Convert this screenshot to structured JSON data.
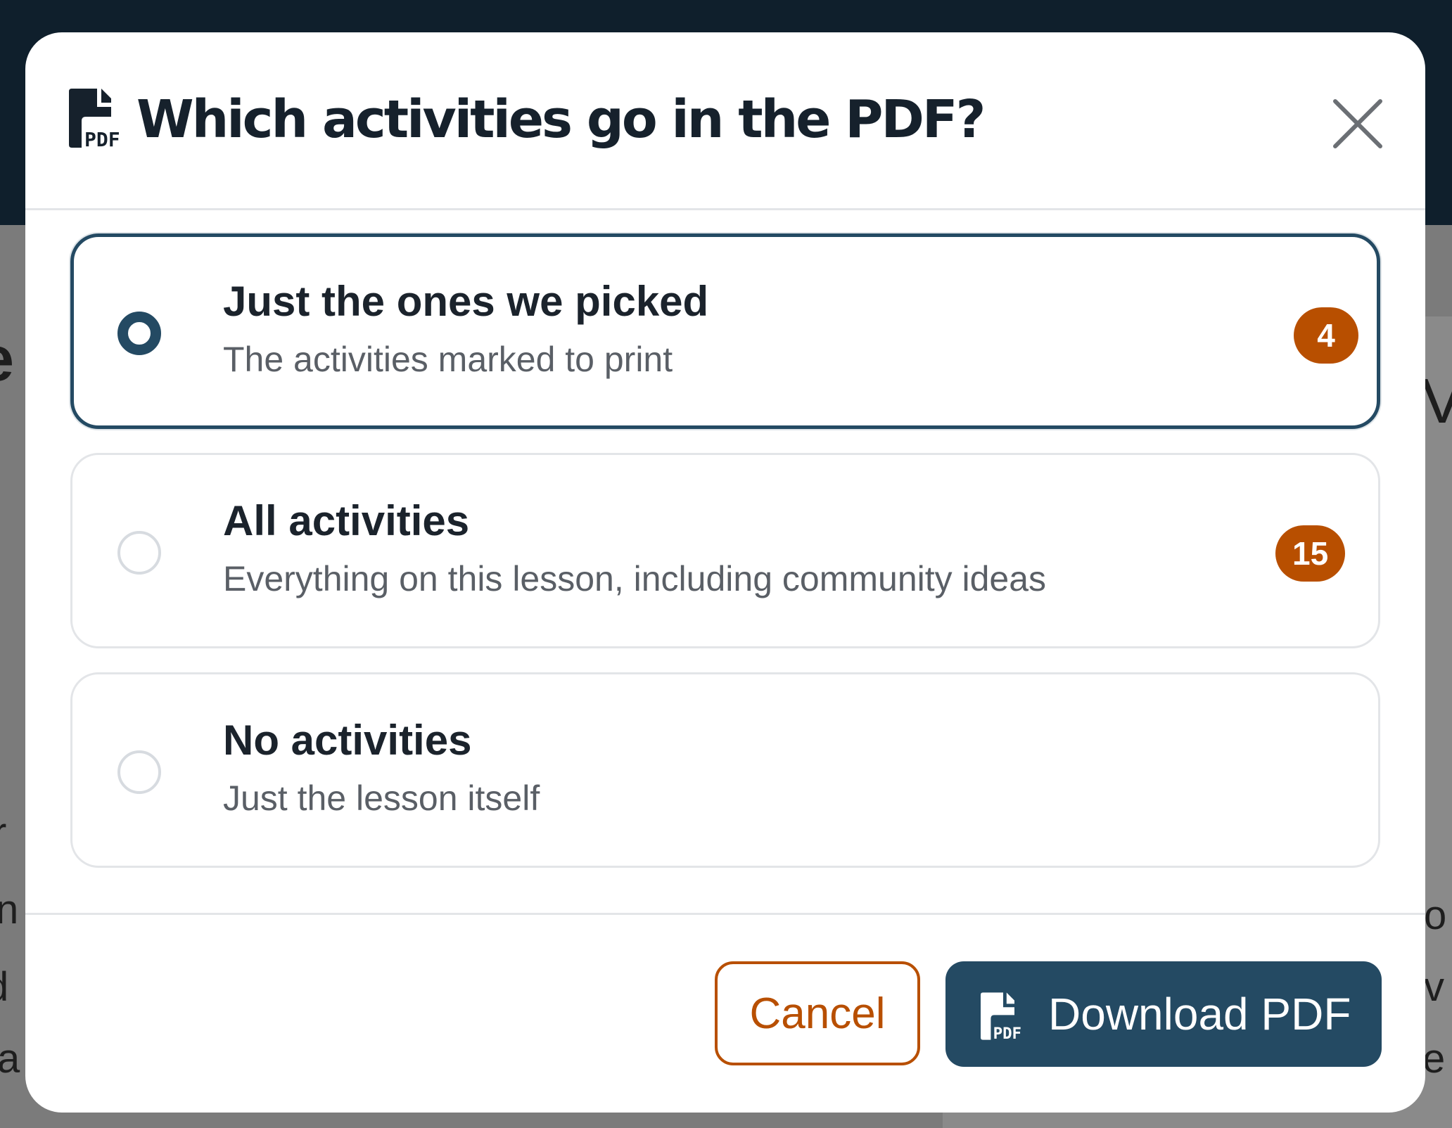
{
  "modal": {
    "title": "Which activities go in the PDF?",
    "icon": "file-pdf-icon",
    "icon_caption": "PDF",
    "close_icon": "close-icon"
  },
  "options": [
    {
      "title": "Just the ones we picked",
      "description": "The activities marked to print",
      "count": "4",
      "selected": true
    },
    {
      "title": "All activities",
      "description": "Everything on this lesson, including community ideas",
      "count": "15",
      "selected": false
    },
    {
      "title": "No activities",
      "description": "Just the lesson itself",
      "count": null,
      "selected": false
    }
  ],
  "footer": {
    "cancel_label": "Cancel",
    "download_label": "Download PDF",
    "download_icon": "file-pdf-icon",
    "download_icon_caption": "PDF"
  },
  "colors": {
    "primary": "#244a63",
    "accent": "#b84f00",
    "title_text": "#16212c",
    "muted_text": "#5a5f66",
    "border": "#e3e5e8",
    "backdrop_topbar": "#0f1f2c"
  }
}
